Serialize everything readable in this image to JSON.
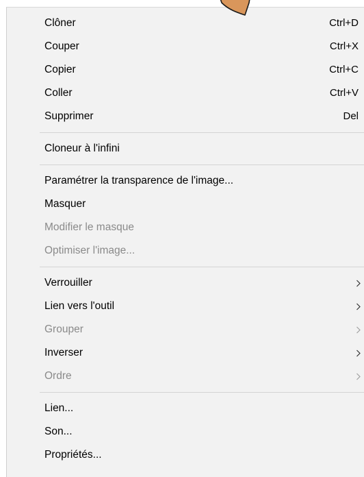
{
  "menu": {
    "groups": [
      {
        "items": [
          {
            "label": "Clôner",
            "shortcut": "Ctrl+D",
            "enabled": true
          },
          {
            "label": "Couper",
            "shortcut": "Ctrl+X",
            "enabled": true
          },
          {
            "label": "Copier",
            "shortcut": "Ctrl+C",
            "enabled": true
          },
          {
            "label": "Coller",
            "shortcut": "Ctrl+V",
            "enabled": true
          },
          {
            "label": "Supprimer",
            "shortcut": "Del",
            "enabled": true
          }
        ]
      },
      {
        "items": [
          {
            "label": "Cloneur à l'infini",
            "enabled": true
          }
        ]
      },
      {
        "items": [
          {
            "label": "Paramétrer la transparence de l'image...",
            "enabled": true
          },
          {
            "label": "Masquer",
            "enabled": true
          },
          {
            "label": "Modifier le masque",
            "enabled": false
          },
          {
            "label": "Optimiser l'image...",
            "enabled": false
          }
        ]
      },
      {
        "items": [
          {
            "label": "Verrouiller",
            "submenu": true,
            "enabled": true
          },
          {
            "label": "Lien vers l'outil",
            "submenu": true,
            "enabled": true
          },
          {
            "label": "Grouper",
            "submenu": true,
            "enabled": false
          },
          {
            "label": "Inverser",
            "submenu": true,
            "enabled": true
          },
          {
            "label": "Ordre",
            "submenu": true,
            "enabled": false
          }
        ]
      },
      {
        "items": [
          {
            "label": "Lien...",
            "enabled": true
          },
          {
            "label": "Son...",
            "enabled": true
          },
          {
            "label": "Propriétés...",
            "enabled": true
          }
        ]
      }
    ]
  },
  "colors": {
    "menu_background": "#f2f2f2",
    "text": "#000000",
    "disabled_text": "#8a8a8a",
    "separator": "#d4d4d4",
    "pointer_fill": "#d9965b",
    "pointer_stroke": "#1a1a1a"
  },
  "icons": {
    "submenu": "chevron-right-icon",
    "pointer": "hand-pointer-icon"
  }
}
